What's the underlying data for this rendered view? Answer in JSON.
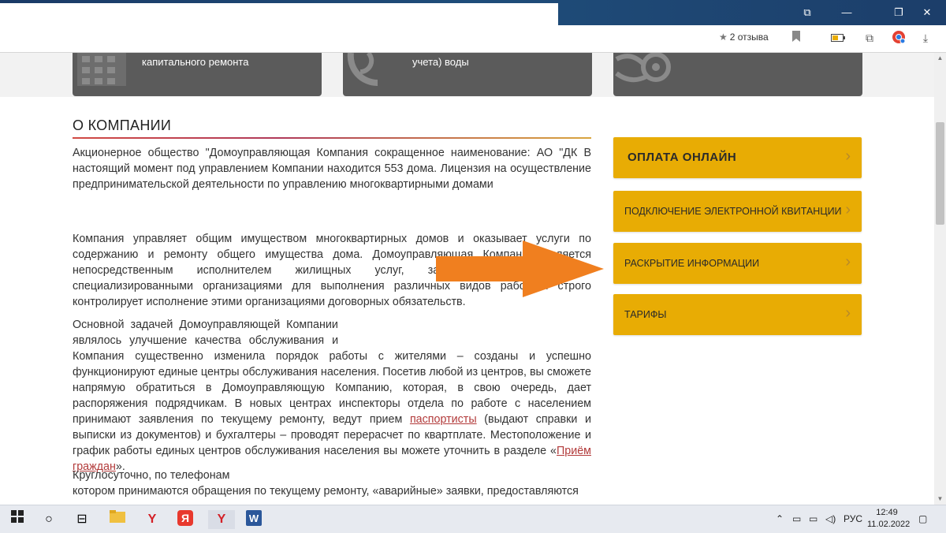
{
  "browser": {
    "reviews_label": "2 отзыва"
  },
  "services": [
    {
      "label_lines": [
        "",
        "капитального ремонта"
      ]
    },
    {
      "label_lines": [
        "",
        "учета) воды"
      ]
    },
    {
      "label_lines": [
        "",
        ""
      ]
    }
  ],
  "section": {
    "title": "О КОМПАНИИ"
  },
  "paragraphs": {
    "p1": "Акционерное общество \"Домоуправляющая Компания                               сокращенное наименование: АО \"ДК                                                                     В настоящий момент под управлением Компании находится 553 дома.     Лицензия на осуществление предпринимательской деятельности по управлению многоквартирными домами",
    "p2": "Компания управляет общим имуществом многоквартирных домов и оказывает услуги по содержанию и ремонту общего имущества дома. Домоуправляющая Компания является непосредственным исполнителем жилищных услуг, заключает договоры со специализированными организациями для выполнения различных видов работ, и строго контролирует исполнение этими организациями договорных обязательств.",
    "p3_line1": "Основной задачей Домоуправляющей Компании",
    "p3_line2": "являлось улучшение качества обслуживания и",
    "p3_rest_a": "Компания существенно изменила порядок работы с жителями – созданы и успешно функционируют единые центры обслуживания населения. Посетив любой из центров, вы сможете напрямую обратиться в Домоуправляющую Компанию, которая, в свою очередь, дает распоряжения подрядчикам. В новых центрах инспекторы отдела по работе с населением принимают заявления по текущему ремонту, ведут прием ",
    "link_passport": "паспортисты",
    "p3_rest_b": " (выдают справки и выписки из документов) и бухгалтеры – проводят перерасчет по квартплате. Местоположение и график работы единых центров обслуживания населения вы можете уточнить в разделе «",
    "link_reception": "Приём граждан",
    "p3_rest_c": "».",
    "p4_line1": "Круглосуточно, по телефонам",
    "p4_line2": "котором принимаются обращения по текущему ремонту, «аварийные» заявки, предоставляются"
  },
  "sidebar": {
    "buttons": [
      {
        "label": "ОПЛАТА ОНЛАЙН"
      },
      {
        "label": "ПОДКЛЮЧЕНИЕ ЭЛЕКТРОННОЙ КВИТАНЦИИ"
      },
      {
        "label": "РАСКРЫТИЕ ИНФОРМАЦИИ"
      },
      {
        "label": "ТАРИФЫ"
      }
    ]
  },
  "taskbar": {
    "language": "РУС",
    "time": "12:49",
    "date": "11.02.2022"
  },
  "colors": {
    "accent_button": "#e8ac04",
    "arrow": "#f07f1f",
    "link": "#b23a3a",
    "service_card": "#5b5b5b"
  }
}
